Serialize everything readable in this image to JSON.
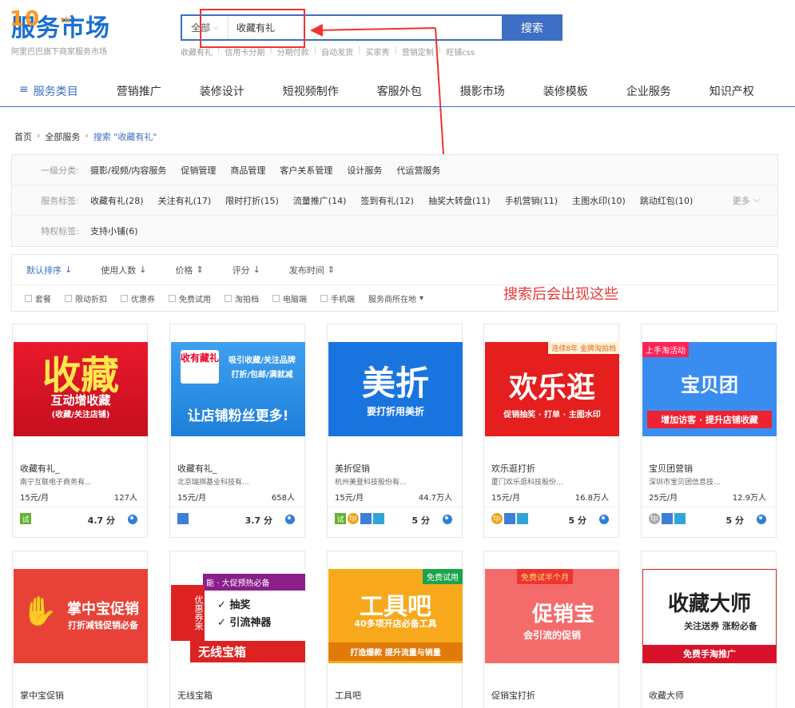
{
  "logo": {
    "ten": "10",
    "th": "th",
    "name": "服务市场",
    "subtitle": "阿里巴巴旗下商家服务市场"
  },
  "search": {
    "scope": "全部",
    "query": "收藏有礼",
    "button": "搜索",
    "hot_words": [
      "收藏有礼",
      "信用卡分期",
      "分期付款",
      "自动发货",
      "买家秀",
      "营销定制",
      "旺铺css"
    ]
  },
  "nav": [
    "服务类目",
    "营销推广",
    "装修设计",
    "短视频制作",
    "客服外包",
    "摄影市场",
    "装修模板",
    "企业服务",
    "知识产权"
  ],
  "breadcrumb": [
    "首页",
    "全部服务",
    "搜索 \"收藏有礼\""
  ],
  "filters": {
    "category": {
      "label": "一级分类:",
      "options": [
        "摄影/视频/内容服务",
        "促销管理",
        "商品管理",
        "客户关系管理",
        "设计服务",
        "代运营服务"
      ]
    },
    "tags": {
      "label": "服务标签:",
      "options": [
        "收藏有礼(28)",
        "关注有礼(17)",
        "限时打折(15)",
        "流量推广(14)",
        "签到有礼(12)",
        "抽奖大转盘(11)",
        "手机营销(11)",
        "主图水印(10)",
        "跳动红包(10)"
      ],
      "more": "更多"
    },
    "privilege": {
      "label": "特权标签:",
      "options": [
        "支持小铺(6)"
      ]
    }
  },
  "sort": [
    "默认排序",
    "使用人数",
    "价格",
    "评分",
    "发布时间"
  ],
  "checks": [
    "套餐",
    "限动折扣",
    "优惠券",
    "免费试用",
    "淘拍档",
    "电脑端",
    "手机端",
    "服务商所在地"
  ],
  "hint": "搜索后会出现这些",
  "cards": [
    {
      "title": "收藏有礼_",
      "company": "南宁互联电子商务有...",
      "price": "15元/月",
      "users": "127人",
      "score": "4.7 分",
      "banner": {
        "big": "收藏",
        "line2": "互动增收藏",
        "line3": "(收藏/关注店铺)"
      }
    },
    {
      "title": "收藏有礼_",
      "company": "北京瑞祺基业科技有...",
      "price": "15元/月",
      "users": "658人",
      "score": "3.7 分",
      "banner": {
        "logo": "收有藏礼",
        "line1": "吸引收藏/关注品牌",
        "line2": "打折/包邮/满就减",
        "line3": "让店铺粉丝更多!"
      }
    },
    {
      "title": "美折促销",
      "company": "杭州美登科技股份有...",
      "price": "15元/月",
      "users": "44.7万人",
      "score": "5 分",
      "banner": {
        "big": "美折",
        "line2": "要打折用美折"
      }
    },
    {
      "title": "欢乐逛打折",
      "company": "厦门欢乐逛科技股份...",
      "price": "15元/月",
      "users": "16.8万人",
      "score": "5 分",
      "banner": {
        "tag": "连续8年 金牌淘拍档",
        "big": "欢乐逛",
        "line2": "促销抽奖 · 打单 · 主图水印"
      }
    },
    {
      "title": "宝贝团营销",
      "company": "深圳市宝贝团信息技...",
      "price": "25元/月",
      "users": "12.9万人",
      "score": "5 分",
      "banner": {
        "tag": "上手淘活动",
        "big": "宝贝团",
        "line2": "增加访客 · 提升店铺收藏"
      }
    },
    {
      "title": "掌中宝促销",
      "company": "",
      "price": "",
      "users": "",
      "score": "",
      "banner": {
        "big": "掌中宝促销",
        "line2": "打折减钱促销必备"
      }
    },
    {
      "title": "无线宝箱",
      "company": "",
      "price": "",
      "users": "",
      "score": "",
      "banner": {
        "tag": "能 · 大促预热必备",
        "line1": "✓ 抽奖",
        "line2": "✓ 引流神器",
        "line3": "无线宝箱",
        "side": "优惠券来"
      }
    },
    {
      "title": "工具吧",
      "company": "",
      "price": "",
      "users": "",
      "score": "",
      "banner": {
        "tag": "免费试用",
        "big": "工具吧",
        "line2": "40多项开店必备工具",
        "line3": "打造爆款 提升流量与销量"
      }
    },
    {
      "title": "促销宝打折",
      "company": "",
      "price": "",
      "users": "",
      "score": "",
      "banner": {
        "tag": "免费试半个月",
        "big": "促销宝",
        "line2": "会引流的促销"
      }
    },
    {
      "title": "收藏大师",
      "company": "",
      "price": "",
      "users": "",
      "score": "",
      "banner": {
        "big": "收藏大师",
        "line2": "关注送券 涨粉必备",
        "line3": "免费手淘推广"
      }
    }
  ]
}
